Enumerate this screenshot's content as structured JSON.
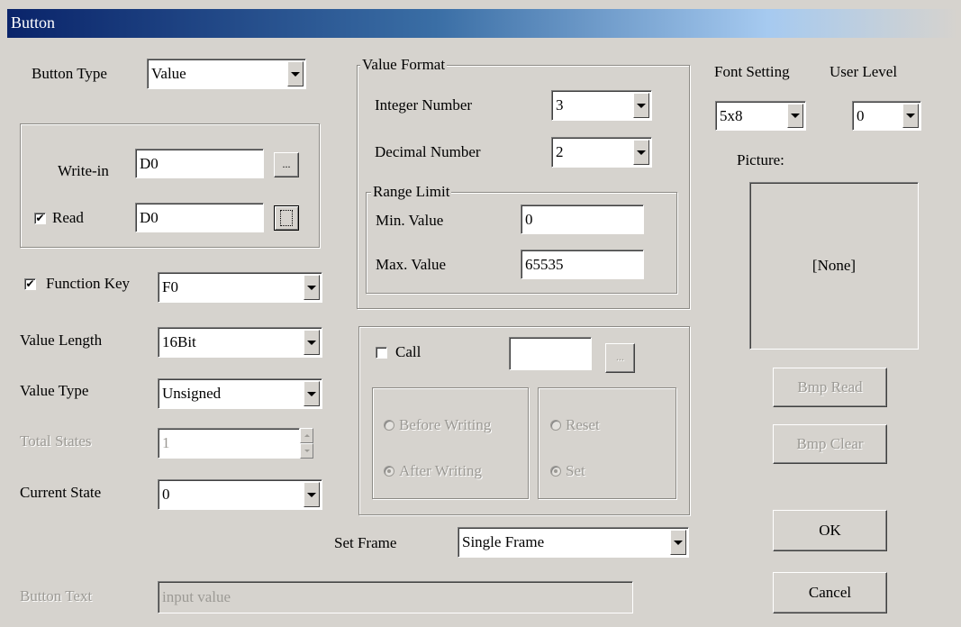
{
  "window": {
    "title": "Button"
  },
  "button_type": {
    "label": "Button Type",
    "value": "Value"
  },
  "write_in": {
    "label": "Write-in",
    "value": "D0",
    "browse": "..."
  },
  "read": {
    "label": "Read",
    "checked": true,
    "value": "D0",
    "browse": "..."
  },
  "function_key": {
    "label": "Function Key",
    "checked": true,
    "value": "F0"
  },
  "value_length": {
    "label": "Value Length",
    "value": "16Bit"
  },
  "value_type": {
    "label": "Value Type",
    "value": "Unsigned"
  },
  "total_states": {
    "label": "Total States",
    "value": "1"
  },
  "current_state": {
    "label": "Current State",
    "value": "0"
  },
  "value_format": {
    "legend": "Value Format",
    "integer": {
      "label": "Integer Number",
      "value": "3"
    },
    "decimal": {
      "label": "Decimal Number",
      "value": "2"
    },
    "range": {
      "legend": "Range Limit",
      "min": {
        "label": "Min. Value",
        "value": "0"
      },
      "max": {
        "label": "Max. Value",
        "value": "65535"
      }
    }
  },
  "call": {
    "label": "Call",
    "checked": false,
    "value": "",
    "browse": "...",
    "before_writing": "Before Writing",
    "after_writing": "After Writing",
    "reset": "Reset",
    "set": "Set"
  },
  "set_frame": {
    "label": "Set Frame",
    "value": "Single Frame"
  },
  "button_text": {
    "label": "Button Text",
    "placeholder": "input value"
  },
  "font_setting": {
    "label": "Font Setting",
    "value": "5x8"
  },
  "user_level": {
    "label": "User Level",
    "value": "0"
  },
  "picture": {
    "label": "Picture:",
    "value": "[None]"
  },
  "buttons": {
    "bmp_read": "Bmp Read",
    "bmp_clear": "Bmp Clear",
    "ok": "OK",
    "cancel": "Cancel"
  },
  "check_glyph": "✔"
}
